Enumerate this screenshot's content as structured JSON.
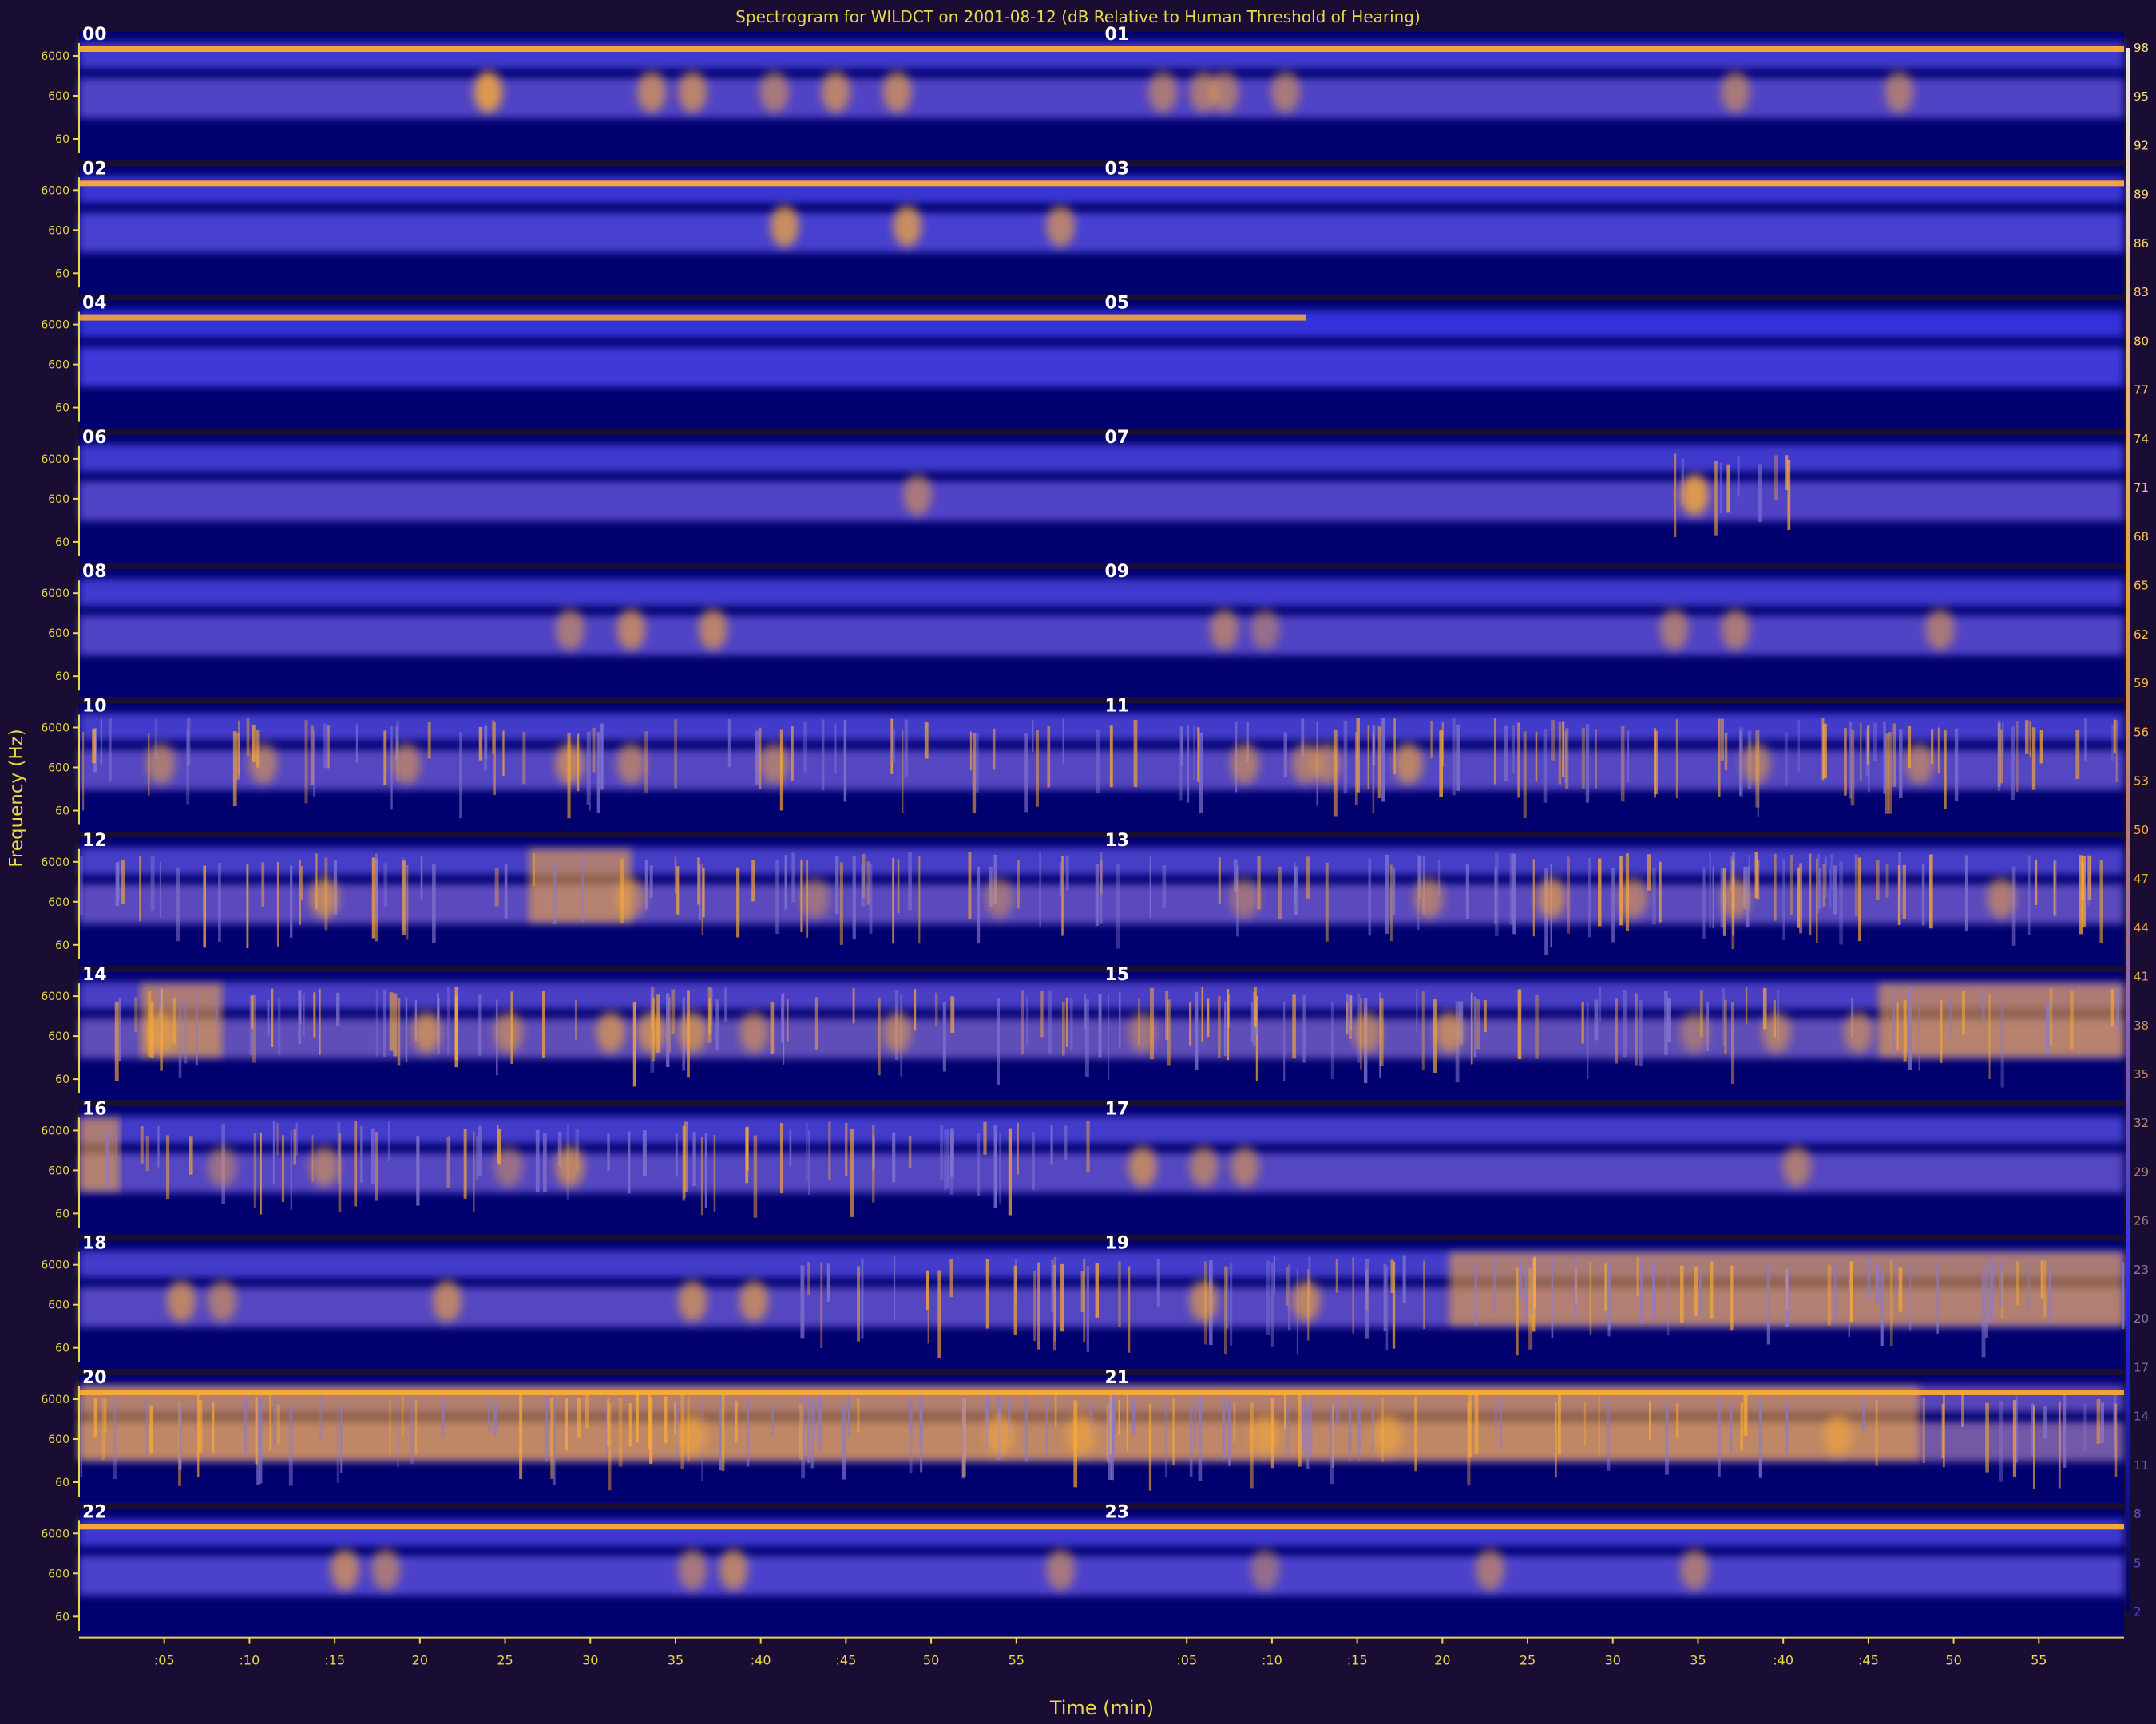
{
  "chart_data": {
    "type": "heatmap",
    "title": "Spectrogram for WILDCT on 2001-08-12 (dB Relative to Human Threshold of Hearing)",
    "xlabel": "Time (min)",
    "ylabel": "Frequency (Hz)",
    "hour_labels": [
      "00",
      "01",
      "02",
      "03",
      "04",
      "05",
      "06",
      "07",
      "08",
      "09",
      "10",
      "11",
      "12",
      "13",
      "14",
      "15",
      "16",
      "17",
      "18",
      "19",
      "20",
      "21",
      "22",
      "23"
    ],
    "y_tick_labels": [
      "6000",
      "600",
      "60"
    ],
    "x_tick_labels": [
      ":05",
      ":10",
      ":15",
      "20",
      "25",
      "30",
      "35",
      ":40",
      ":45",
      "50",
      "55"
    ],
    "colorbar_ticks": [
      98,
      95,
      92,
      89,
      86,
      83,
      80,
      77,
      74,
      71,
      68,
      65,
      62,
      59,
      56,
      53,
      50,
      47,
      44,
      41,
      38,
      35,
      32,
      29,
      26,
      23,
      20,
      17,
      14,
      11,
      8,
      5,
      2
    ],
    "grid": false,
    "colors": {
      "background": "#1a0d33",
      "plot_bg": "#00006e",
      "mid": "#2a30ff",
      "hot": "#ffae30",
      "text": "#e8d84a"
    },
    "rows": [
      {
        "hours": [
          "00",
          "01"
        ],
        "tone_level": 0.95,
        "tone_extent": 1.0,
        "band_level": 0.45,
        "events": [
          [
            0.2,
            0.8
          ],
          [
            0.28,
            0.6
          ],
          [
            0.3,
            0.6
          ],
          [
            0.34,
            0.5
          ],
          [
            0.37,
            0.6
          ],
          [
            0.4,
            0.6
          ],
          [
            0.53,
            0.5
          ],
          [
            0.55,
            0.5
          ],
          [
            0.56,
            0.5
          ],
          [
            0.59,
            0.5
          ],
          [
            0.81,
            0.5
          ],
          [
            0.89,
            0.5
          ]
        ],
        "bursts": [],
        "flood": []
      },
      {
        "hours": [
          "02",
          "03"
        ],
        "tone_level": 0.95,
        "tone_extent": 1.0,
        "band_level": 0.35,
        "events": [
          [
            0.345,
            0.7
          ],
          [
            0.405,
            0.7
          ],
          [
            0.48,
            0.6
          ]
        ],
        "bursts": [],
        "flood": []
      },
      {
        "hours": [
          "04",
          "05"
        ],
        "tone_level": 0.85,
        "tone_extent": 0.6,
        "band_level": 0.25,
        "events": [],
        "bursts": [],
        "flood": []
      },
      {
        "hours": [
          "06",
          "07"
        ],
        "tone_level": 0.0,
        "tone_extent": 0.0,
        "band_level": 0.45,
        "events": [
          [
            0.41,
            0.5
          ],
          [
            0.79,
            0.8
          ]
        ],
        "bursts": [
          [
            0.78,
            0.84
          ]
        ],
        "flood": []
      },
      {
        "hours": [
          "08",
          "09"
        ],
        "tone_level": 0.0,
        "tone_extent": 0.0,
        "band_level": 0.45,
        "events": [
          [
            0.24,
            0.5
          ],
          [
            0.27,
            0.6
          ],
          [
            0.31,
            0.6
          ],
          [
            0.56,
            0.5
          ],
          [
            0.58,
            0.4
          ],
          [
            0.78,
            0.5
          ],
          [
            0.81,
            0.5
          ],
          [
            0.91,
            0.5
          ]
        ],
        "bursts": [],
        "flood": []
      },
      {
        "hours": [
          "10",
          "11"
        ],
        "tone_level": 0.0,
        "tone_extent": 0.0,
        "band_level": 0.5,
        "events": [
          [
            0.04,
            0.5
          ],
          [
            0.09,
            0.5
          ],
          [
            0.16,
            0.5
          ],
          [
            0.24,
            0.6
          ],
          [
            0.27,
            0.5
          ],
          [
            0.34,
            0.5
          ],
          [
            0.57,
            0.5
          ],
          [
            0.6,
            0.5
          ],
          [
            0.61,
            0.5
          ],
          [
            0.65,
            0.6
          ],
          [
            0.82,
            0.5
          ],
          [
            0.9,
            0.5
          ]
        ],
        "bursts": [
          [
            0.0,
            1.0
          ]
        ],
        "flood": []
      },
      {
        "hours": [
          "12",
          "13"
        ],
        "tone_level": 0.0,
        "tone_extent": 0.0,
        "band_level": 0.55,
        "events": [
          [
            0.12,
            0.6
          ],
          [
            0.27,
            0.5
          ],
          [
            0.36,
            0.4
          ],
          [
            0.45,
            0.4
          ],
          [
            0.57,
            0.4
          ],
          [
            0.66,
            0.5
          ],
          [
            0.72,
            0.6
          ],
          [
            0.76,
            0.5
          ],
          [
            0.81,
            0.5
          ],
          [
            0.94,
            0.5
          ]
        ],
        "bursts": [
          [
            0.0,
            1.0
          ]
        ],
        "flood": [
          [
            0.22,
            0.27
          ]
        ]
      },
      {
        "hours": [
          "14",
          "15"
        ],
        "tone_level": 0.0,
        "tone_extent": 0.0,
        "band_level": 0.6,
        "events": [
          [
            0.04,
            0.5
          ],
          [
            0.17,
            0.6
          ],
          [
            0.21,
            0.5
          ],
          [
            0.26,
            0.6
          ],
          [
            0.28,
            0.6
          ],
          [
            0.3,
            0.6
          ],
          [
            0.33,
            0.5
          ],
          [
            0.4,
            0.5
          ],
          [
            0.52,
            0.4
          ],
          [
            0.63,
            0.5
          ],
          [
            0.67,
            0.6
          ],
          [
            0.79,
            0.4
          ],
          [
            0.83,
            0.5
          ],
          [
            0.87,
            0.5
          ]
        ],
        "bursts": [
          [
            0.0,
            1.0
          ]
        ],
        "flood": [
          [
            0.03,
            0.07
          ],
          [
            0.88,
            1.0
          ]
        ]
      },
      {
        "hours": [
          "16",
          "17"
        ],
        "tone_level": 0.0,
        "tone_extent": 0.0,
        "band_level": 0.5,
        "events": [
          [
            0.07,
            0.4
          ],
          [
            0.12,
            0.5
          ],
          [
            0.21,
            0.4
          ],
          [
            0.24,
            0.6
          ],
          [
            0.52,
            0.6
          ],
          [
            0.55,
            0.5
          ],
          [
            0.57,
            0.5
          ],
          [
            0.84,
            0.5
          ]
        ],
        "bursts": [
          [
            0.0,
            0.5
          ]
        ],
        "flood": [
          [
            0.0,
            0.02
          ]
        ]
      },
      {
        "hours": [
          "18",
          "19"
        ],
        "tone_level": 0.0,
        "tone_extent": 0.0,
        "band_level": 0.5,
        "events": [
          [
            0.05,
            0.6
          ],
          [
            0.07,
            0.5
          ],
          [
            0.18,
            0.6
          ],
          [
            0.3,
            0.6
          ],
          [
            0.33,
            0.6
          ],
          [
            0.55,
            0.6
          ],
          [
            0.6,
            0.6
          ]
        ],
        "bursts": [
          [
            0.35,
            1.0
          ]
        ],
        "flood": [
          [
            0.67,
            1.0
          ]
        ]
      },
      {
        "hours": [
          "20",
          "21"
        ],
        "tone_level": 0.9,
        "tone_extent": 1.0,
        "band_level": 0.8,
        "events": [
          [
            0.3,
            0.5
          ],
          [
            0.45,
            0.5
          ],
          [
            0.49,
            0.5
          ],
          [
            0.58,
            0.5
          ],
          [
            0.64,
            0.5
          ],
          [
            0.86,
            0.5
          ]
        ],
        "bursts": [
          [
            0.0,
            1.0
          ]
        ],
        "flood": [
          [
            0.0,
            0.9
          ]
        ]
      },
      {
        "hours": [
          "22",
          "23"
        ],
        "tone_level": 0.95,
        "tone_extent": 1.0,
        "band_level": 0.4,
        "events": [
          [
            0.13,
            0.6
          ],
          [
            0.15,
            0.5
          ],
          [
            0.3,
            0.5
          ],
          [
            0.32,
            0.6
          ],
          [
            0.48,
            0.5
          ],
          [
            0.58,
            0.4
          ],
          [
            0.69,
            0.5
          ],
          [
            0.79,
            0.5
          ]
        ],
        "bursts": [],
        "flood": []
      }
    ]
  }
}
